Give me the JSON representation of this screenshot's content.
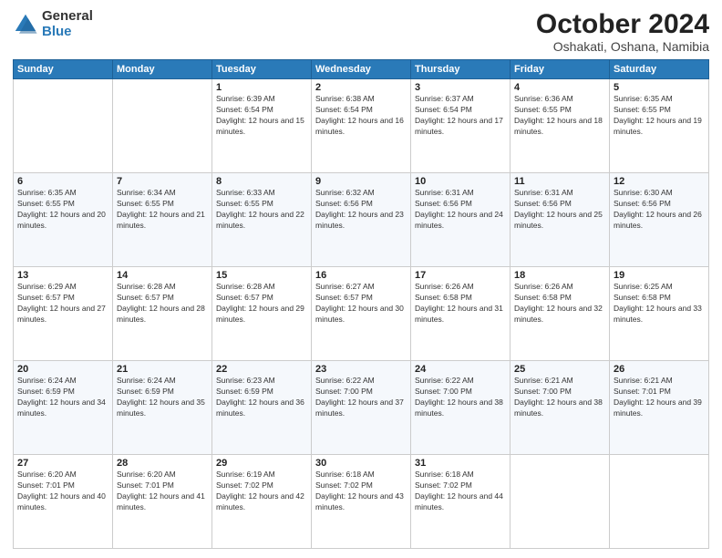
{
  "logo": {
    "general": "General",
    "blue": "Blue"
  },
  "title": {
    "month": "October 2024",
    "location": "Oshakati, Oshana, Namibia"
  },
  "days_of_week": [
    "Sunday",
    "Monday",
    "Tuesday",
    "Wednesday",
    "Thursday",
    "Friday",
    "Saturday"
  ],
  "weeks": [
    [
      {
        "day": "",
        "sunrise": "",
        "sunset": "",
        "daylight": ""
      },
      {
        "day": "",
        "sunrise": "",
        "sunset": "",
        "daylight": ""
      },
      {
        "day": "1",
        "sunrise": "Sunrise: 6:39 AM",
        "sunset": "Sunset: 6:54 PM",
        "daylight": "Daylight: 12 hours and 15 minutes."
      },
      {
        "day": "2",
        "sunrise": "Sunrise: 6:38 AM",
        "sunset": "Sunset: 6:54 PM",
        "daylight": "Daylight: 12 hours and 16 minutes."
      },
      {
        "day": "3",
        "sunrise": "Sunrise: 6:37 AM",
        "sunset": "Sunset: 6:54 PM",
        "daylight": "Daylight: 12 hours and 17 minutes."
      },
      {
        "day": "4",
        "sunrise": "Sunrise: 6:36 AM",
        "sunset": "Sunset: 6:55 PM",
        "daylight": "Daylight: 12 hours and 18 minutes."
      },
      {
        "day": "5",
        "sunrise": "Sunrise: 6:35 AM",
        "sunset": "Sunset: 6:55 PM",
        "daylight": "Daylight: 12 hours and 19 minutes."
      }
    ],
    [
      {
        "day": "6",
        "sunrise": "Sunrise: 6:35 AM",
        "sunset": "Sunset: 6:55 PM",
        "daylight": "Daylight: 12 hours and 20 minutes."
      },
      {
        "day": "7",
        "sunrise": "Sunrise: 6:34 AM",
        "sunset": "Sunset: 6:55 PM",
        "daylight": "Daylight: 12 hours and 21 minutes."
      },
      {
        "day": "8",
        "sunrise": "Sunrise: 6:33 AM",
        "sunset": "Sunset: 6:55 PM",
        "daylight": "Daylight: 12 hours and 22 minutes."
      },
      {
        "day": "9",
        "sunrise": "Sunrise: 6:32 AM",
        "sunset": "Sunset: 6:56 PM",
        "daylight": "Daylight: 12 hours and 23 minutes."
      },
      {
        "day": "10",
        "sunrise": "Sunrise: 6:31 AM",
        "sunset": "Sunset: 6:56 PM",
        "daylight": "Daylight: 12 hours and 24 minutes."
      },
      {
        "day": "11",
        "sunrise": "Sunrise: 6:31 AM",
        "sunset": "Sunset: 6:56 PM",
        "daylight": "Daylight: 12 hours and 25 minutes."
      },
      {
        "day": "12",
        "sunrise": "Sunrise: 6:30 AM",
        "sunset": "Sunset: 6:56 PM",
        "daylight": "Daylight: 12 hours and 26 minutes."
      }
    ],
    [
      {
        "day": "13",
        "sunrise": "Sunrise: 6:29 AM",
        "sunset": "Sunset: 6:57 PM",
        "daylight": "Daylight: 12 hours and 27 minutes."
      },
      {
        "day": "14",
        "sunrise": "Sunrise: 6:28 AM",
        "sunset": "Sunset: 6:57 PM",
        "daylight": "Daylight: 12 hours and 28 minutes."
      },
      {
        "day": "15",
        "sunrise": "Sunrise: 6:28 AM",
        "sunset": "Sunset: 6:57 PM",
        "daylight": "Daylight: 12 hours and 29 minutes."
      },
      {
        "day": "16",
        "sunrise": "Sunrise: 6:27 AM",
        "sunset": "Sunset: 6:57 PM",
        "daylight": "Daylight: 12 hours and 30 minutes."
      },
      {
        "day": "17",
        "sunrise": "Sunrise: 6:26 AM",
        "sunset": "Sunset: 6:58 PM",
        "daylight": "Daylight: 12 hours and 31 minutes."
      },
      {
        "day": "18",
        "sunrise": "Sunrise: 6:26 AM",
        "sunset": "Sunset: 6:58 PM",
        "daylight": "Daylight: 12 hours and 32 minutes."
      },
      {
        "day": "19",
        "sunrise": "Sunrise: 6:25 AM",
        "sunset": "Sunset: 6:58 PM",
        "daylight": "Daylight: 12 hours and 33 minutes."
      }
    ],
    [
      {
        "day": "20",
        "sunrise": "Sunrise: 6:24 AM",
        "sunset": "Sunset: 6:59 PM",
        "daylight": "Daylight: 12 hours and 34 minutes."
      },
      {
        "day": "21",
        "sunrise": "Sunrise: 6:24 AM",
        "sunset": "Sunset: 6:59 PM",
        "daylight": "Daylight: 12 hours and 35 minutes."
      },
      {
        "day": "22",
        "sunrise": "Sunrise: 6:23 AM",
        "sunset": "Sunset: 6:59 PM",
        "daylight": "Daylight: 12 hours and 36 minutes."
      },
      {
        "day": "23",
        "sunrise": "Sunrise: 6:22 AM",
        "sunset": "Sunset: 7:00 PM",
        "daylight": "Daylight: 12 hours and 37 minutes."
      },
      {
        "day": "24",
        "sunrise": "Sunrise: 6:22 AM",
        "sunset": "Sunset: 7:00 PM",
        "daylight": "Daylight: 12 hours and 38 minutes."
      },
      {
        "day": "25",
        "sunrise": "Sunrise: 6:21 AM",
        "sunset": "Sunset: 7:00 PM",
        "daylight": "Daylight: 12 hours and 38 minutes."
      },
      {
        "day": "26",
        "sunrise": "Sunrise: 6:21 AM",
        "sunset": "Sunset: 7:01 PM",
        "daylight": "Daylight: 12 hours and 39 minutes."
      }
    ],
    [
      {
        "day": "27",
        "sunrise": "Sunrise: 6:20 AM",
        "sunset": "Sunset: 7:01 PM",
        "daylight": "Daylight: 12 hours and 40 minutes."
      },
      {
        "day": "28",
        "sunrise": "Sunrise: 6:20 AM",
        "sunset": "Sunset: 7:01 PM",
        "daylight": "Daylight: 12 hours and 41 minutes."
      },
      {
        "day": "29",
        "sunrise": "Sunrise: 6:19 AM",
        "sunset": "Sunset: 7:02 PM",
        "daylight": "Daylight: 12 hours and 42 minutes."
      },
      {
        "day": "30",
        "sunrise": "Sunrise: 6:18 AM",
        "sunset": "Sunset: 7:02 PM",
        "daylight": "Daylight: 12 hours and 43 minutes."
      },
      {
        "day": "31",
        "sunrise": "Sunrise: 6:18 AM",
        "sunset": "Sunset: 7:02 PM",
        "daylight": "Daylight: 12 hours and 44 minutes."
      },
      {
        "day": "",
        "sunrise": "",
        "sunset": "",
        "daylight": ""
      },
      {
        "day": "",
        "sunrise": "",
        "sunset": "",
        "daylight": ""
      }
    ]
  ]
}
